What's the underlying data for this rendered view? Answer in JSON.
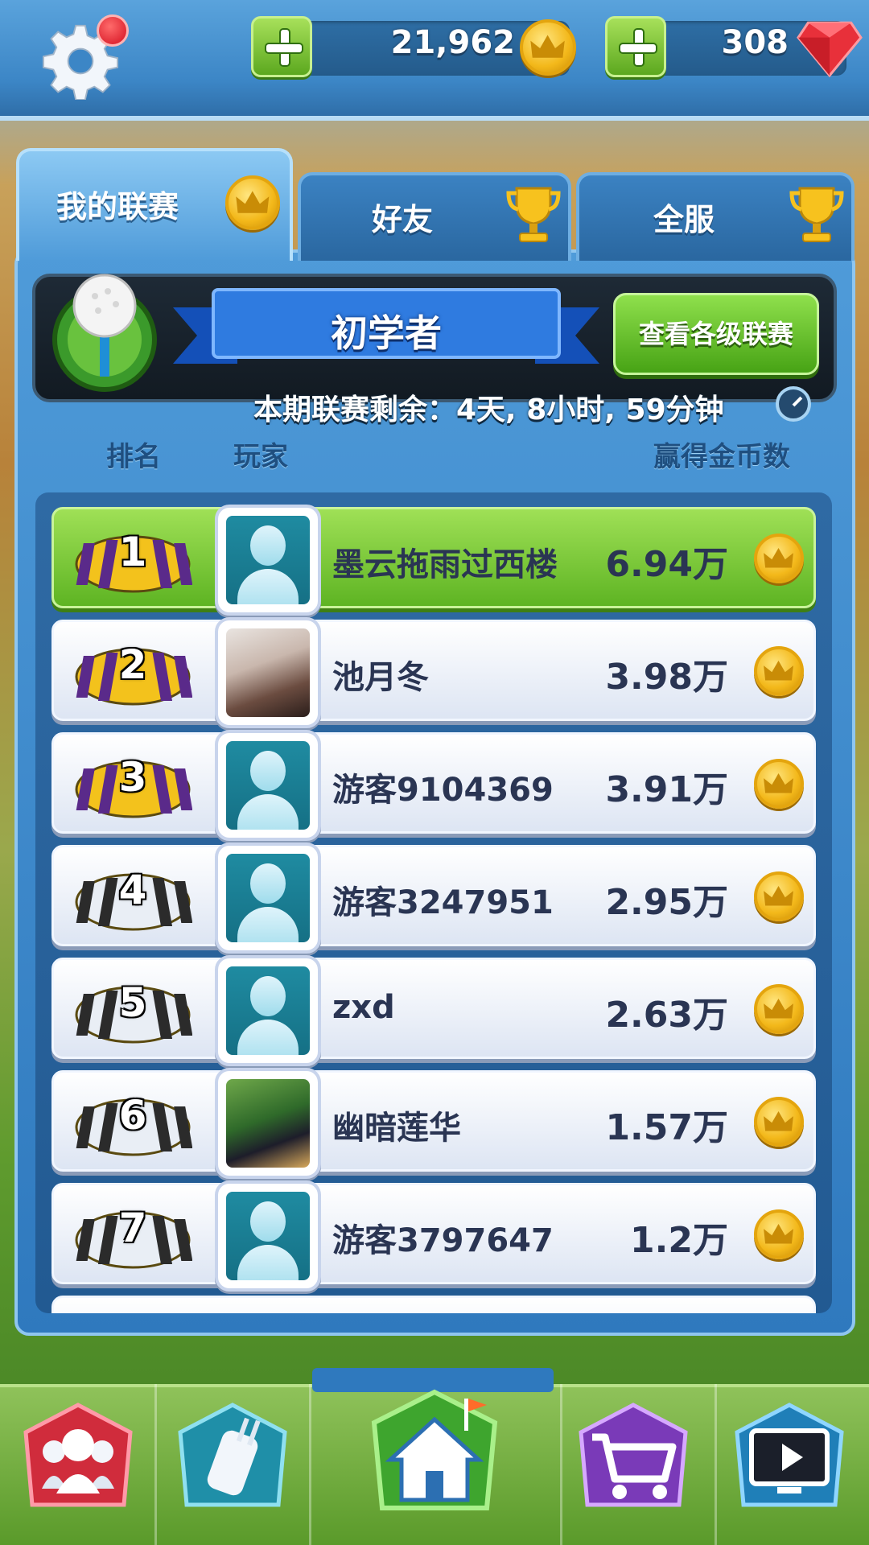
{
  "currency": {
    "coins": "21,962",
    "gems": "308"
  },
  "tabs": [
    {
      "label": "我的联赛"
    },
    {
      "label": "好友"
    },
    {
      "label": "全服"
    }
  ],
  "league": {
    "name": "初学者",
    "view_button": "查看各级联赛",
    "countdown": "本期联赛剩余：4天, 8小时, 59分钟"
  },
  "columns": {
    "rank": "排名",
    "player": "玩家",
    "coins": "赢得金币数"
  },
  "rows": [
    {
      "rank": "1",
      "name": "墨云拖雨过西楼",
      "coins": "6.94万",
      "chest": "gold",
      "avatar": "default",
      "highlight": true
    },
    {
      "rank": "2",
      "name": "池月冬",
      "coins": "3.98万",
      "chest": "gold",
      "avatar": "photo"
    },
    {
      "rank": "3",
      "name": "游客9104369",
      "coins": "3.91万",
      "chest": "gold",
      "avatar": "default"
    },
    {
      "rank": "4",
      "name": "游客3247951",
      "coins": "2.95万",
      "chest": "silver",
      "avatar": "default"
    },
    {
      "rank": "5",
      "name": "zxd",
      "coins": "2.63万",
      "chest": "silver",
      "avatar": "default"
    },
    {
      "rank": "6",
      "name": "幽暗莲华",
      "coins": "1.57万",
      "chest": "silver",
      "avatar": "photo"
    },
    {
      "rank": "7",
      "name": "游客3797647",
      "coins": "1.2万",
      "chest": "silver",
      "avatar": "default"
    }
  ],
  "nav": [
    {
      "icon": "friends-icon"
    },
    {
      "icon": "golf-bag-icon"
    },
    {
      "icon": "home-icon"
    },
    {
      "icon": "shop-cart-icon"
    },
    {
      "icon": "replay-video-icon"
    }
  ],
  "colors": {
    "panel_blue": "#2f79be",
    "highlight_green": "#5eb423",
    "gold": "#f3b81a"
  }
}
